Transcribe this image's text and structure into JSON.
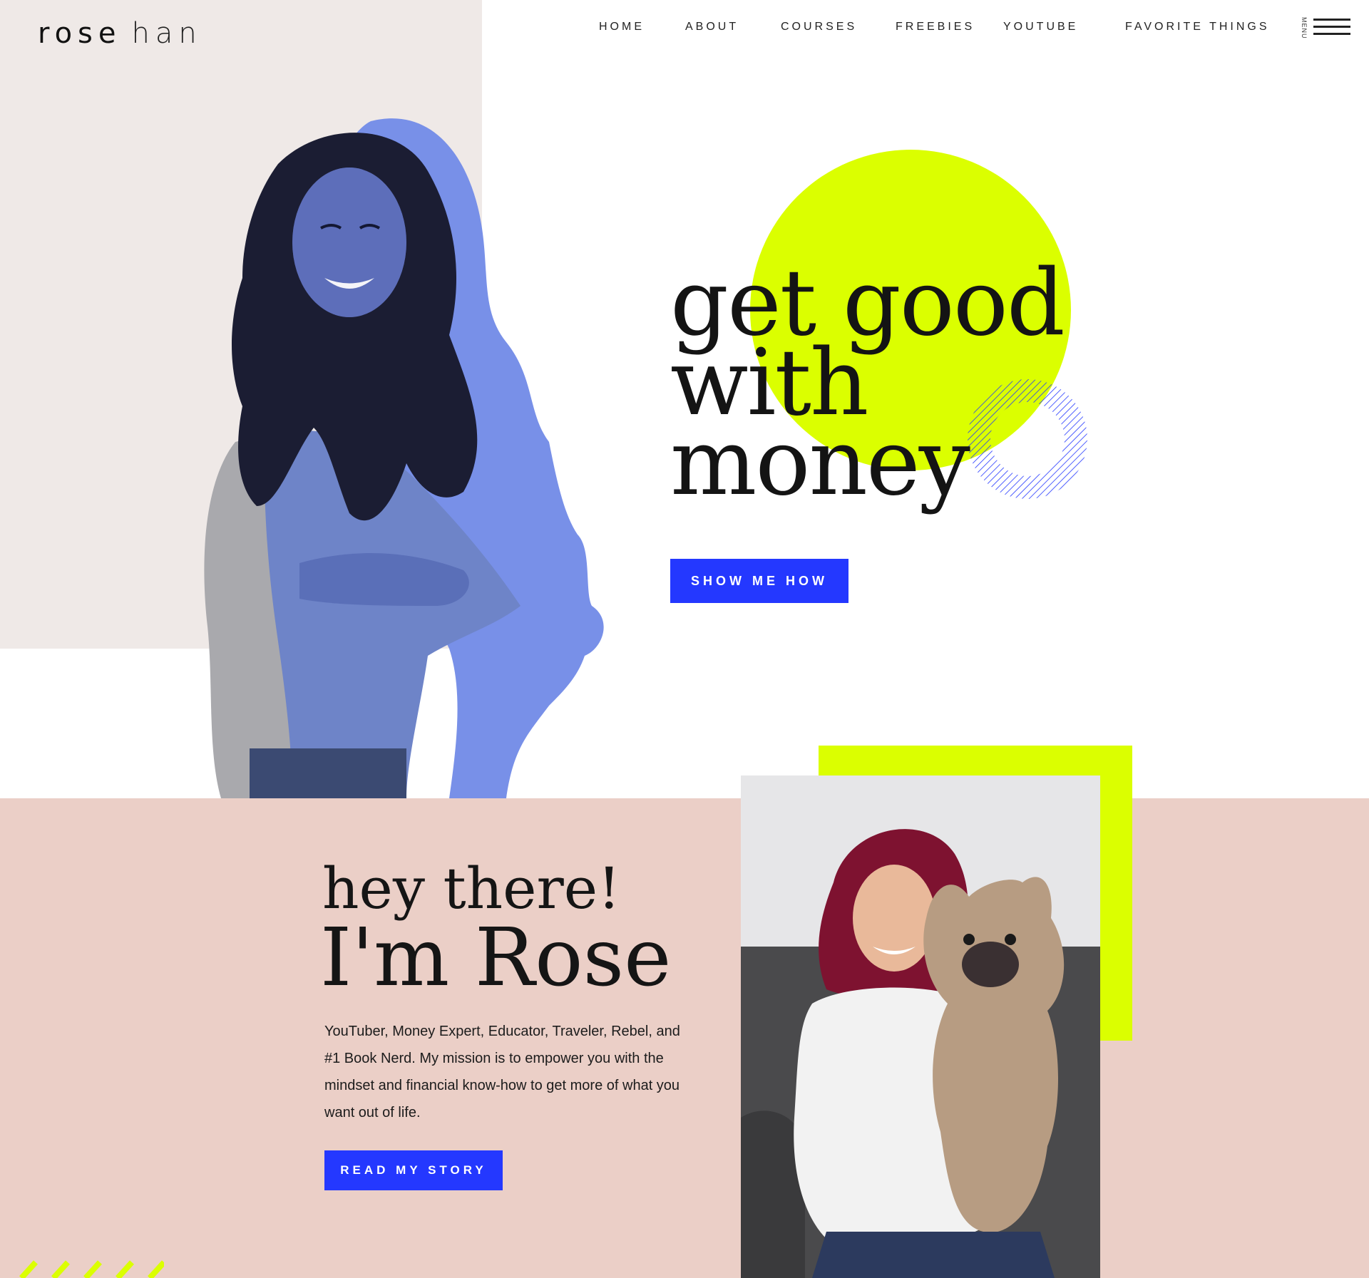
{
  "brand": {
    "first": "rose",
    "last": "han"
  },
  "nav": {
    "items": [
      {
        "label": "HOME"
      },
      {
        "label": "ABOUT"
      },
      {
        "label": "COURSES"
      },
      {
        "label": "FREEBIES"
      },
      {
        "label": "YOUTUBE"
      },
      {
        "label": "FAVORITE THINGS"
      }
    ],
    "menu_label": "MENU"
  },
  "hero": {
    "headline": [
      "get good",
      "with",
      "money"
    ],
    "cta": "SHOW ME HOW"
  },
  "about": {
    "greeting": "hey there!",
    "name_line": "I'm Rose",
    "bio": "YouTuber, Money Expert, Educator, Traveler, Rebel, and #1 Book Nerd. My mission is to empower you with the mindset and financial know-how to get more of what you want out of life.",
    "cta": "READ MY STORY"
  },
  "colors": {
    "accent_blue": "#2438ff",
    "lime": "#dbff00",
    "blush": "#ebcfc7",
    "panel": "#efe9e7"
  }
}
